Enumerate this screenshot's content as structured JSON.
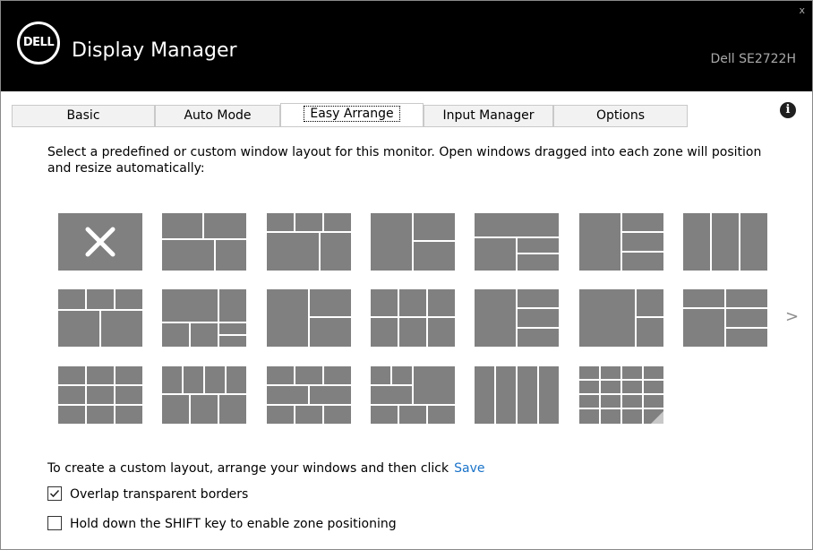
{
  "window": {
    "logo_text": "DELL",
    "title": "Display Manager",
    "model": "Dell SE2722H",
    "close_label": "x"
  },
  "tabs": [
    {
      "label": "Basic",
      "active": false
    },
    {
      "label": "Auto Mode",
      "active": false
    },
    {
      "label": "Easy Arrange",
      "active": true
    },
    {
      "label": "Input Manager",
      "active": false
    },
    {
      "label": "Options",
      "active": false
    }
  ],
  "info_label": "i",
  "description": "Select a predefined or custom window layout for this monitor.  Open windows dragged into each zone will position and resize automatically:",
  "layouts": [
    {
      "id": "none",
      "icon": "close-icon"
    },
    {
      "id": "2top-2bottom-offset"
    },
    {
      "id": "3top-2bottom"
    },
    {
      "id": "left-right-split-right"
    },
    {
      "id": "left-right-split-right-2"
    },
    {
      "id": "left-right-stacked-right"
    },
    {
      "id": "3-columns"
    },
    {
      "id": "3top-2bottom-wide"
    },
    {
      "id": "left-right-split-right-3"
    },
    {
      "id": "left-2right"
    },
    {
      "id": "3top-3bottom"
    },
    {
      "id": "left-3right"
    },
    {
      "id": "2-columns-split"
    },
    {
      "id": "3-col-split-left"
    },
    {
      "id": "3x2-grid"
    },
    {
      "id": "4top-3bottom"
    },
    {
      "id": "3top-3bottom-alt"
    },
    {
      "id": "4top-3bottom-wide"
    },
    {
      "id": "4-columns"
    },
    {
      "id": "4x3-custom"
    }
  ],
  "next_label": ">",
  "custom_text": "To create a custom layout, arrange your windows and then click",
  "save_label": "Save",
  "options": [
    {
      "label": "Overlap transparent borders",
      "checked": true
    },
    {
      "label": "Hold down the SHIFT key to enable zone positioning",
      "checked": false
    }
  ],
  "colors": {
    "layout_fill": "#808080",
    "link": "#1a73c9"
  }
}
